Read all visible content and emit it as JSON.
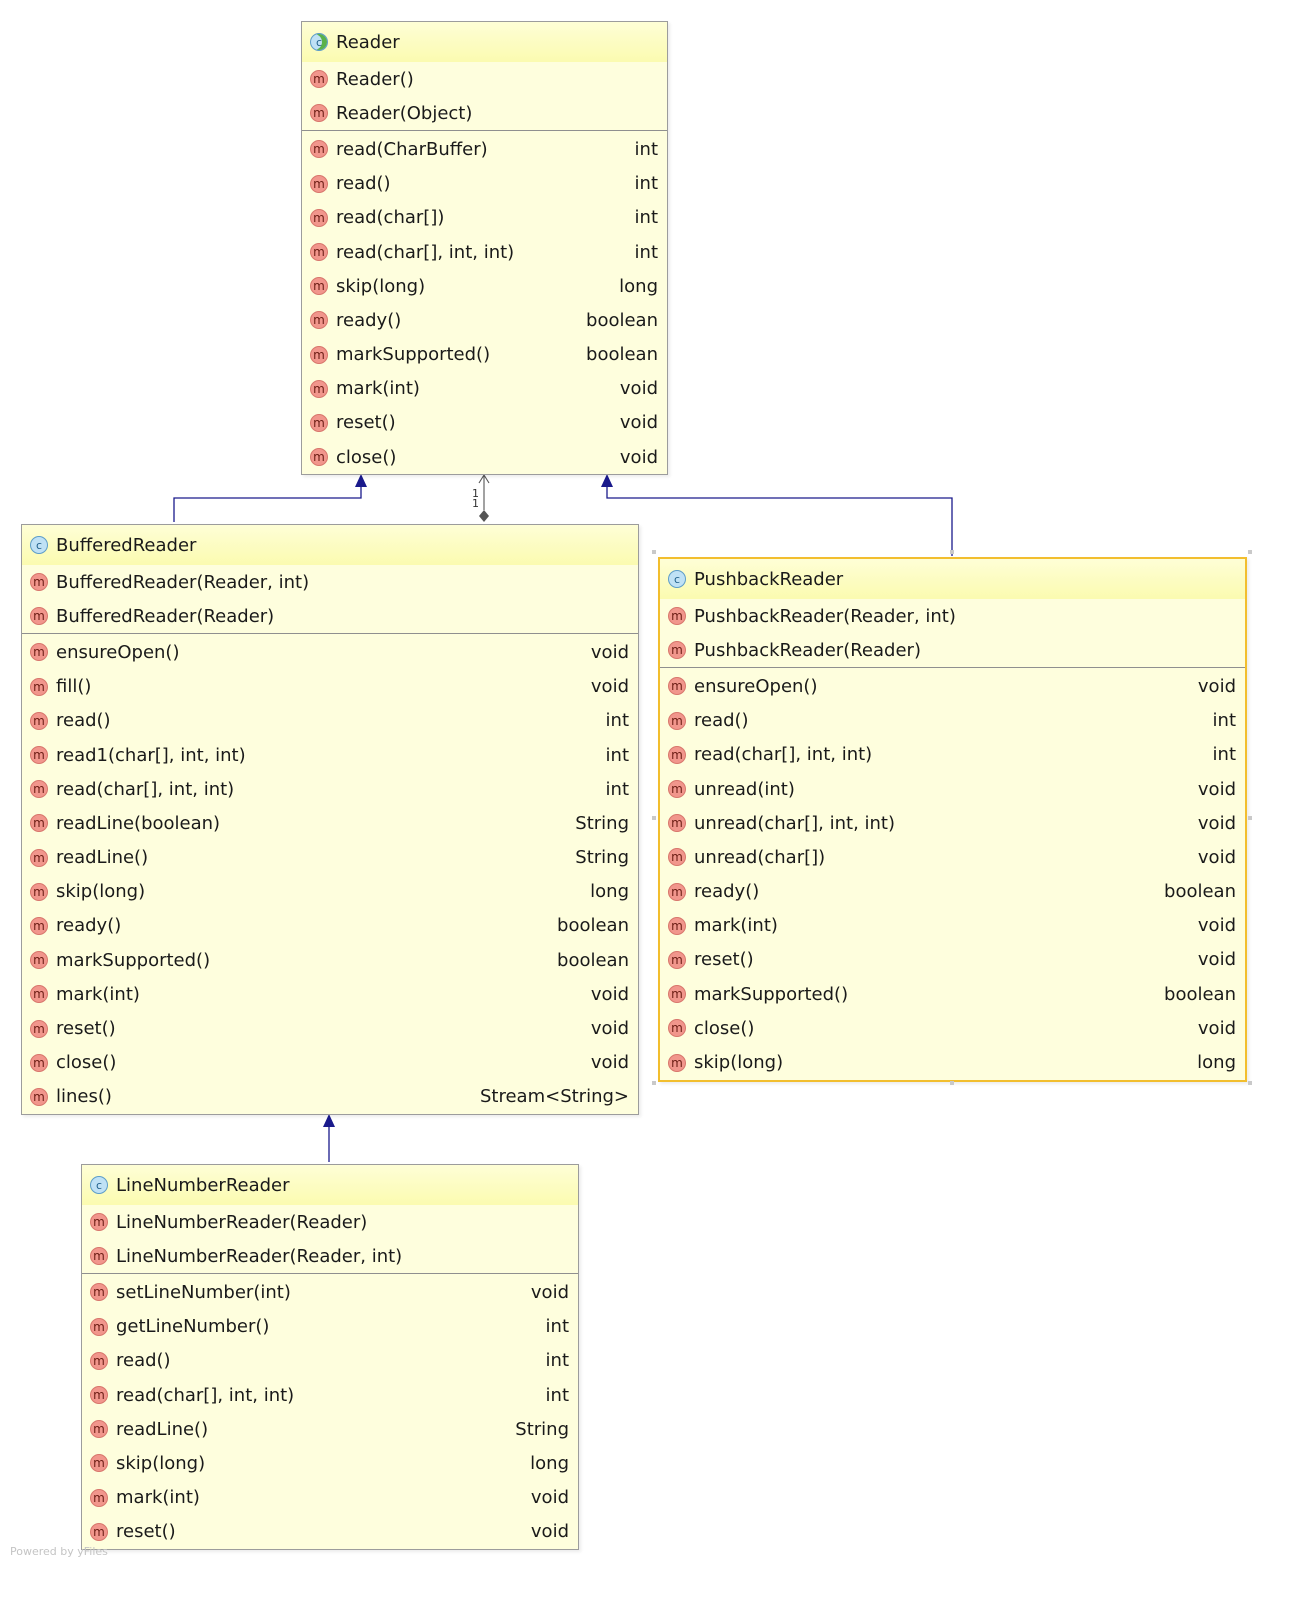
{
  "classes": [
    {
      "name": "Reader",
      "icon": "abstract-class-icon",
      "constructors": [
        "Reader()",
        "Reader(Object)"
      ],
      "methods": [
        {
          "name": "read(CharBuffer)",
          "type": "int"
        },
        {
          "name": "read()",
          "type": "int"
        },
        {
          "name": "read(char[])",
          "type": "int"
        },
        {
          "name": "read(char[], int, int)",
          "type": "int"
        },
        {
          "name": "skip(long)",
          "type": "long"
        },
        {
          "name": "ready()",
          "type": "boolean"
        },
        {
          "name": "markSupported()",
          "type": "boolean"
        },
        {
          "name": "mark(int)",
          "type": "void"
        },
        {
          "name": "reset()",
          "type": "void"
        },
        {
          "name": "close()",
          "type": "void"
        }
      ]
    },
    {
      "name": "BufferedReader",
      "icon": "class-icon",
      "constructors": [
        "BufferedReader(Reader, int)",
        "BufferedReader(Reader)"
      ],
      "methods": [
        {
          "name": "ensureOpen()",
          "type": "void"
        },
        {
          "name": "fill()",
          "type": "void"
        },
        {
          "name": "read()",
          "type": "int"
        },
        {
          "name": "read1(char[], int, int)",
          "type": "int"
        },
        {
          "name": "read(char[], int, int)",
          "type": "int"
        },
        {
          "name": "readLine(boolean)",
          "type": "String"
        },
        {
          "name": "readLine()",
          "type": "String"
        },
        {
          "name": "skip(long)",
          "type": "long"
        },
        {
          "name": "ready()",
          "type": "boolean"
        },
        {
          "name": "markSupported()",
          "type": "boolean"
        },
        {
          "name": "mark(int)",
          "type": "void"
        },
        {
          "name": "reset()",
          "type": "void"
        },
        {
          "name": "close()",
          "type": "void"
        },
        {
          "name": "lines()",
          "type": "Stream<String>"
        }
      ]
    },
    {
      "name": "PushbackReader",
      "icon": "class-icon",
      "selected": true,
      "constructors": [
        "PushbackReader(Reader, int)",
        "PushbackReader(Reader)"
      ],
      "methods": [
        {
          "name": "ensureOpen()",
          "type": "void"
        },
        {
          "name": "read()",
          "type": "int"
        },
        {
          "name": "read(char[], int, int)",
          "type": "int"
        },
        {
          "name": "unread(int)",
          "type": "void"
        },
        {
          "name": "unread(char[], int, int)",
          "type": "void"
        },
        {
          "name": "unread(char[])",
          "type": "void"
        },
        {
          "name": "ready()",
          "type": "boolean"
        },
        {
          "name": "mark(int)",
          "type": "void"
        },
        {
          "name": "reset()",
          "type": "void"
        },
        {
          "name": "markSupported()",
          "type": "boolean"
        },
        {
          "name": "close()",
          "type": "void"
        },
        {
          "name": "skip(long)",
          "type": "long"
        }
      ]
    },
    {
      "name": "LineNumberReader",
      "icon": "class-icon",
      "constructors": [
        "LineNumberReader(Reader)",
        "LineNumberReader(Reader, int)"
      ],
      "methods": [
        {
          "name": "setLineNumber(int)",
          "type": "void"
        },
        {
          "name": "getLineNumber()",
          "type": "int"
        },
        {
          "name": "read()",
          "type": "int"
        },
        {
          "name": "read(char[], int, int)",
          "type": "int"
        },
        {
          "name": "readLine()",
          "type": "String"
        },
        {
          "name": "skip(long)",
          "type": "long"
        },
        {
          "name": "mark(int)",
          "type": "void"
        },
        {
          "name": "reset()",
          "type": "void"
        }
      ]
    }
  ],
  "edges": [
    {
      "from": "BufferedReader",
      "to": "Reader",
      "kind": "inheritance"
    },
    {
      "from": "PushbackReader",
      "to": "Reader",
      "kind": "inheritance"
    },
    {
      "from": "LineNumberReader",
      "to": "BufferedReader",
      "kind": "inheritance"
    },
    {
      "from": "BufferedReader",
      "to": "Reader",
      "kind": "composition",
      "multiplicity": [
        "1",
        "1"
      ]
    }
  ],
  "icon_glyphs": {
    "method": "m",
    "class": "c"
  },
  "colors": {
    "node_fill": "#fefedd",
    "header_fill": "#fbfbb0",
    "edge": "#1a1a8c",
    "selection": "#f2be2e",
    "method_icon": "#f1968c",
    "class_icon": "#bfe1f5"
  },
  "footer": "Powered by yFiles"
}
